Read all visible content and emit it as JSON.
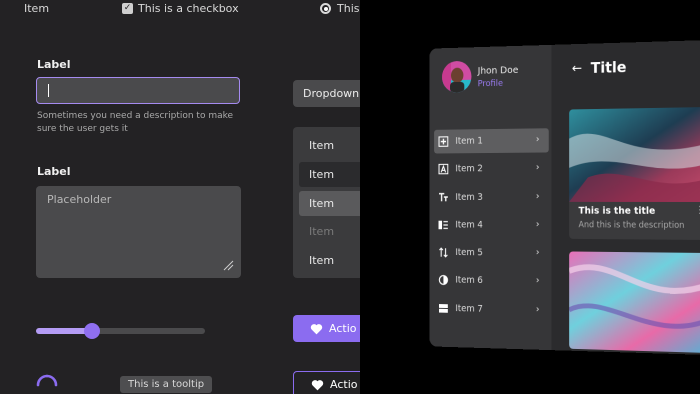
{
  "kit": {
    "top_item": "Item",
    "checkbox_label": "This is a checkbox",
    "radio_label": "This",
    "field1": {
      "label": "Label",
      "value": "",
      "description": "Sometimes you need a description to make sure the user gets it"
    },
    "field2": {
      "label": "Label",
      "placeholder": "Placeholder"
    },
    "slider": {
      "value": 0.33
    },
    "tooltip": "This is a tooltip",
    "dropdown": "Dropdown",
    "menu": [
      {
        "label": "Item",
        "state": "default"
      },
      {
        "label": "Item",
        "state": "hover"
      },
      {
        "label": "Item",
        "state": "selected"
      },
      {
        "label": "Item",
        "state": "disabled"
      },
      {
        "label": "Item",
        "state": "default"
      }
    ],
    "action_filled": "Actio",
    "action_outline": "Actio",
    "accent": "#8b6cf0"
  },
  "app": {
    "user": {
      "name": "Jhon Doe",
      "role": "Profile"
    },
    "title": "Title",
    "back_icon": "arrow-left-icon",
    "nav": [
      {
        "label": "Item 1",
        "icon": "add-box-icon",
        "active": true
      },
      {
        "label": "Item 2",
        "icon": "font-a-icon",
        "active": false
      },
      {
        "label": "Item 3",
        "icon": "text-size-icon",
        "active": false
      },
      {
        "label": "Item 4",
        "icon": "list-icon",
        "active": false
      },
      {
        "label": "Item 5",
        "icon": "sort-arrows-icon",
        "active": false
      },
      {
        "label": "Item 6",
        "icon": "contrast-icon",
        "active": false
      },
      {
        "label": "Item 7",
        "icon": "split-icon",
        "active": false
      }
    ],
    "card": {
      "title": "This is the title",
      "description": "And this is the description"
    }
  }
}
